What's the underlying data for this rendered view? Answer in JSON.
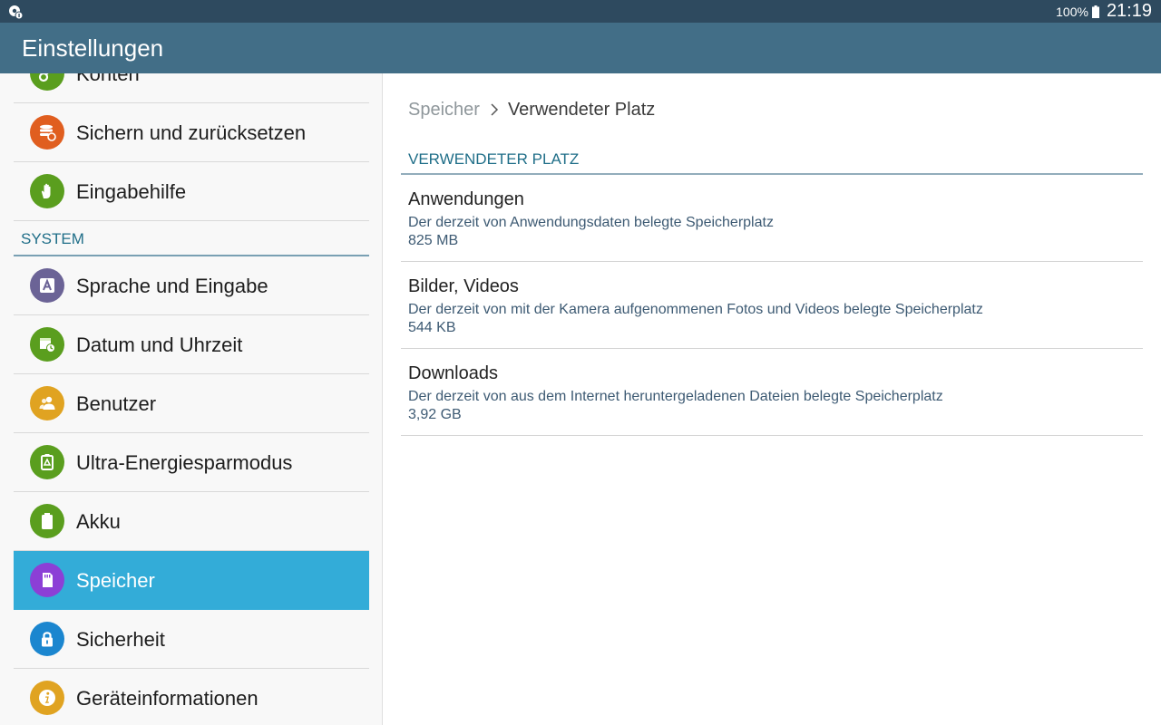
{
  "status_bar": {
    "battery": "100%",
    "time": "21:19"
  },
  "app_bar": {
    "title": "Einstellungen"
  },
  "sidebar": {
    "items_before": [
      {
        "name": "sidebar-item-konten",
        "label": "Konten",
        "icon": "key-icon",
        "color": "#5a9e1e"
      },
      {
        "name": "sidebar-item-sichern",
        "label": "Sichern und zurücksetzen",
        "icon": "backup-icon",
        "color": "#e05e1f"
      },
      {
        "name": "sidebar-item-eingabehilfe",
        "label": "Eingabehilfe",
        "icon": "hand-icon",
        "color": "#5a9e1e"
      }
    ],
    "section_header": "SYSTEM",
    "items_after": [
      {
        "name": "sidebar-item-sprache",
        "label": "Sprache und Eingabe",
        "icon": "language-icon",
        "color": "#6b6396"
      },
      {
        "name": "sidebar-item-datum",
        "label": "Datum und Uhrzeit",
        "icon": "calendar-clock-icon",
        "color": "#5a9e1e"
      },
      {
        "name": "sidebar-item-benutzer",
        "label": "Benutzer",
        "icon": "users-icon",
        "color": "#e0a321"
      },
      {
        "name": "sidebar-item-ultra-energiesparmodus",
        "label": "Ultra-Energiesparmodus",
        "icon": "eco-battery-icon",
        "color": "#5a9e1e"
      },
      {
        "name": "sidebar-item-akku",
        "label": "Akku",
        "icon": "battery-icon",
        "color": "#5a9e1e"
      },
      {
        "name": "sidebar-item-speicher",
        "label": "Speicher",
        "icon": "sd-card-icon",
        "color": "#8c3fd6",
        "selected": true
      },
      {
        "name": "sidebar-item-sicherheit",
        "label": "Sicherheit",
        "icon": "lock-icon",
        "color": "#1b86cf"
      },
      {
        "name": "sidebar-item-geraeteinformationen",
        "label": "Geräteinformationen",
        "icon": "info-icon",
        "color": "#e0a321"
      }
    ]
  },
  "content": {
    "breadcrumb": {
      "parent": "Speicher",
      "current": "Verwendeter Platz"
    },
    "section_header": "VERWENDETER PLATZ",
    "entries": [
      {
        "title": "Anwendungen",
        "description": "Der derzeit von Anwendungsdaten belegte Speicherplatz",
        "size": "825 MB"
      },
      {
        "title": "Bilder, Videos",
        "description": "Der derzeit von mit der Kamera aufgenommenen Fotos und Videos belegte Speicherplatz",
        "size": "544 KB"
      },
      {
        "title": "Downloads",
        "description": "Der derzeit von aus dem Internet heruntergeladenen Dateien belegte Speicherplatz",
        "size": "3,92 GB"
      }
    ]
  }
}
